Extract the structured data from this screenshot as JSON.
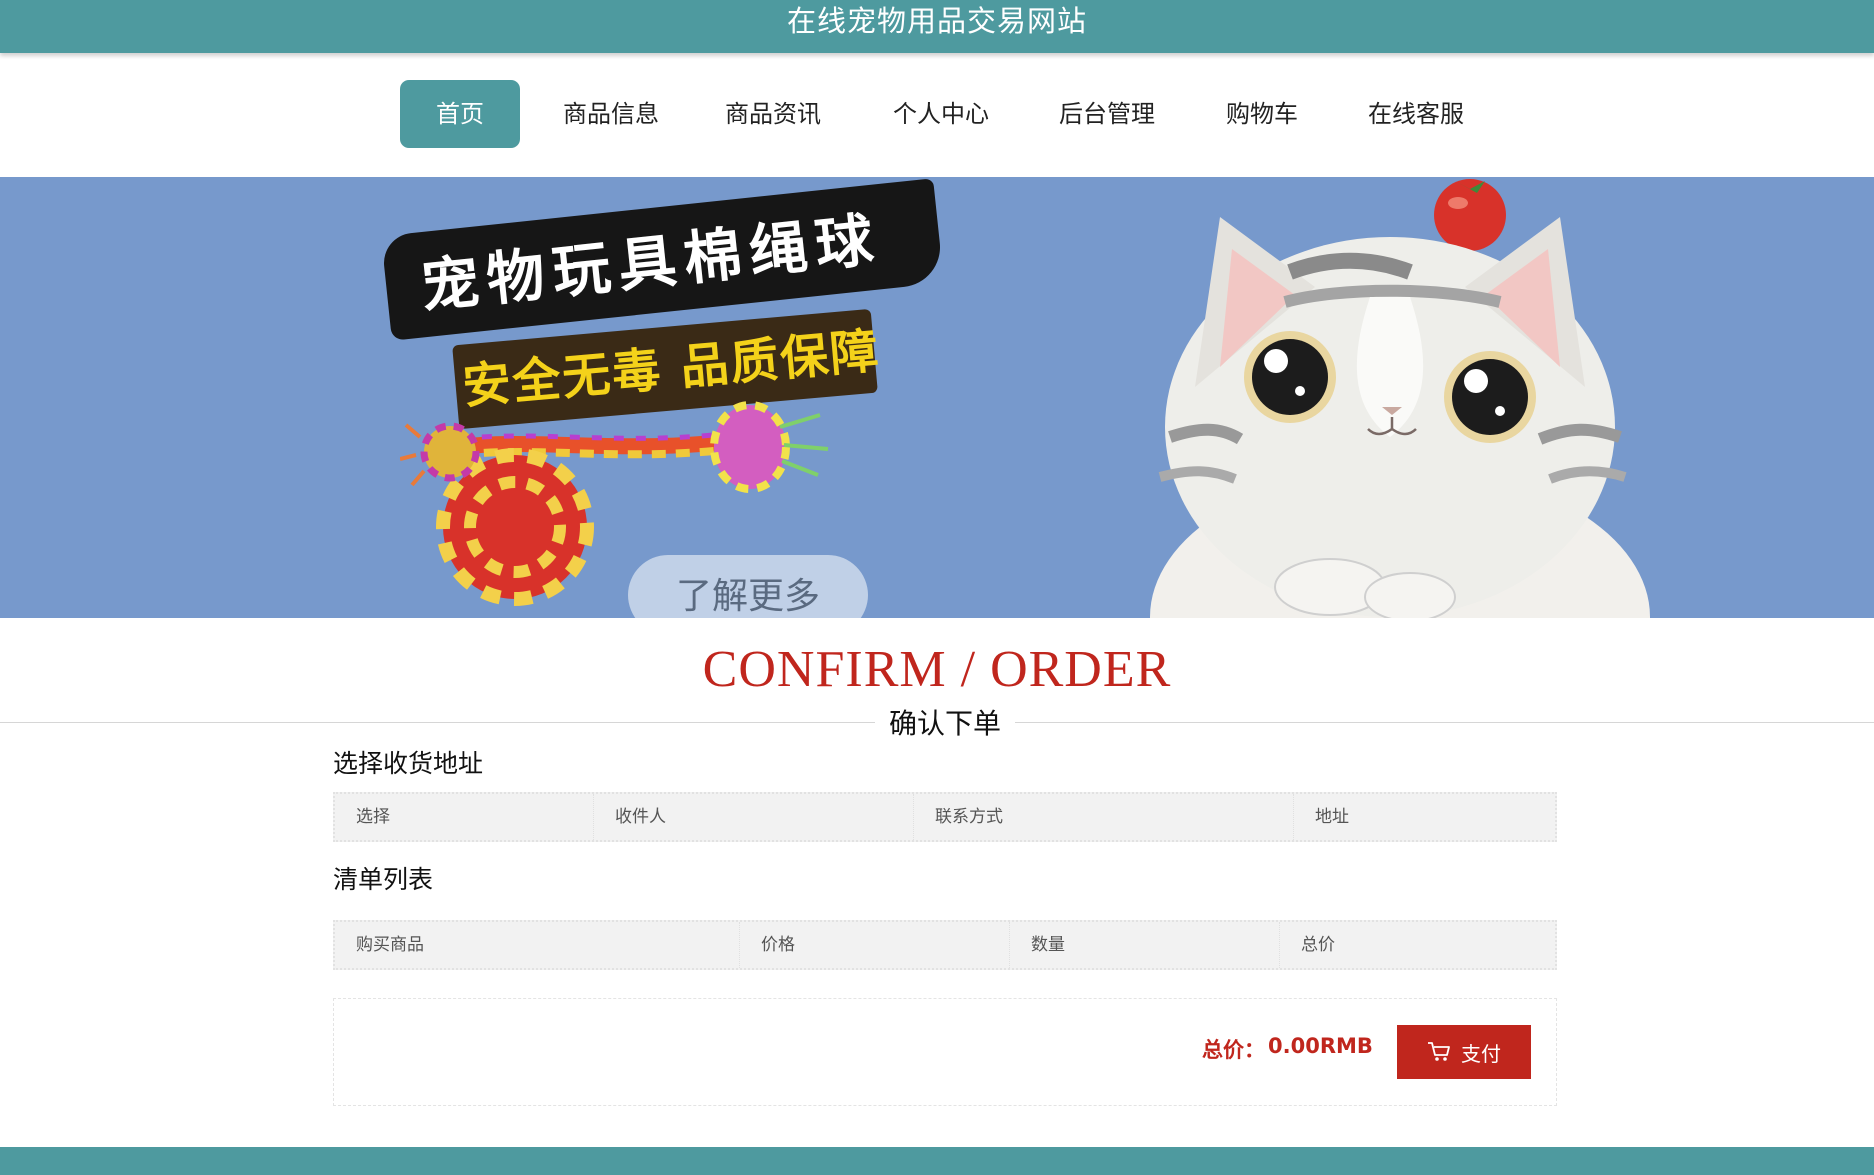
{
  "header": {
    "title": "在线宠物用品交易网站"
  },
  "nav": {
    "items": [
      {
        "label": "首页",
        "active": true
      },
      {
        "label": "商品信息",
        "active": false
      },
      {
        "label": "商品资讯",
        "active": false
      },
      {
        "label": "个人中心",
        "active": false
      },
      {
        "label": "后台管理",
        "active": false
      },
      {
        "label": "购物车",
        "active": false
      },
      {
        "label": "在线客服",
        "active": false
      }
    ]
  },
  "banner": {
    "headline": "宠物玩具棉绳球",
    "tagline": "安全无毒 品质保障",
    "more_label": "了解更多"
  },
  "page": {
    "title_en": "CONFIRM / ORDER",
    "title_cn": "确认下单"
  },
  "address_section": {
    "title": "选择收货地址",
    "columns": [
      "选择",
      "收件人",
      "联系方式",
      "地址"
    ]
  },
  "items_section": {
    "title": "清单列表",
    "columns": [
      "购买商品",
      "价格",
      "数量",
      "总价"
    ]
  },
  "summary": {
    "total_label": "总价：",
    "total_value": "0.00RMB",
    "pay_label": "支付"
  },
  "colors": {
    "brand_teal": "#4e9a9f",
    "accent_red": "#c0261d",
    "banner_blue": "#7799cc"
  }
}
